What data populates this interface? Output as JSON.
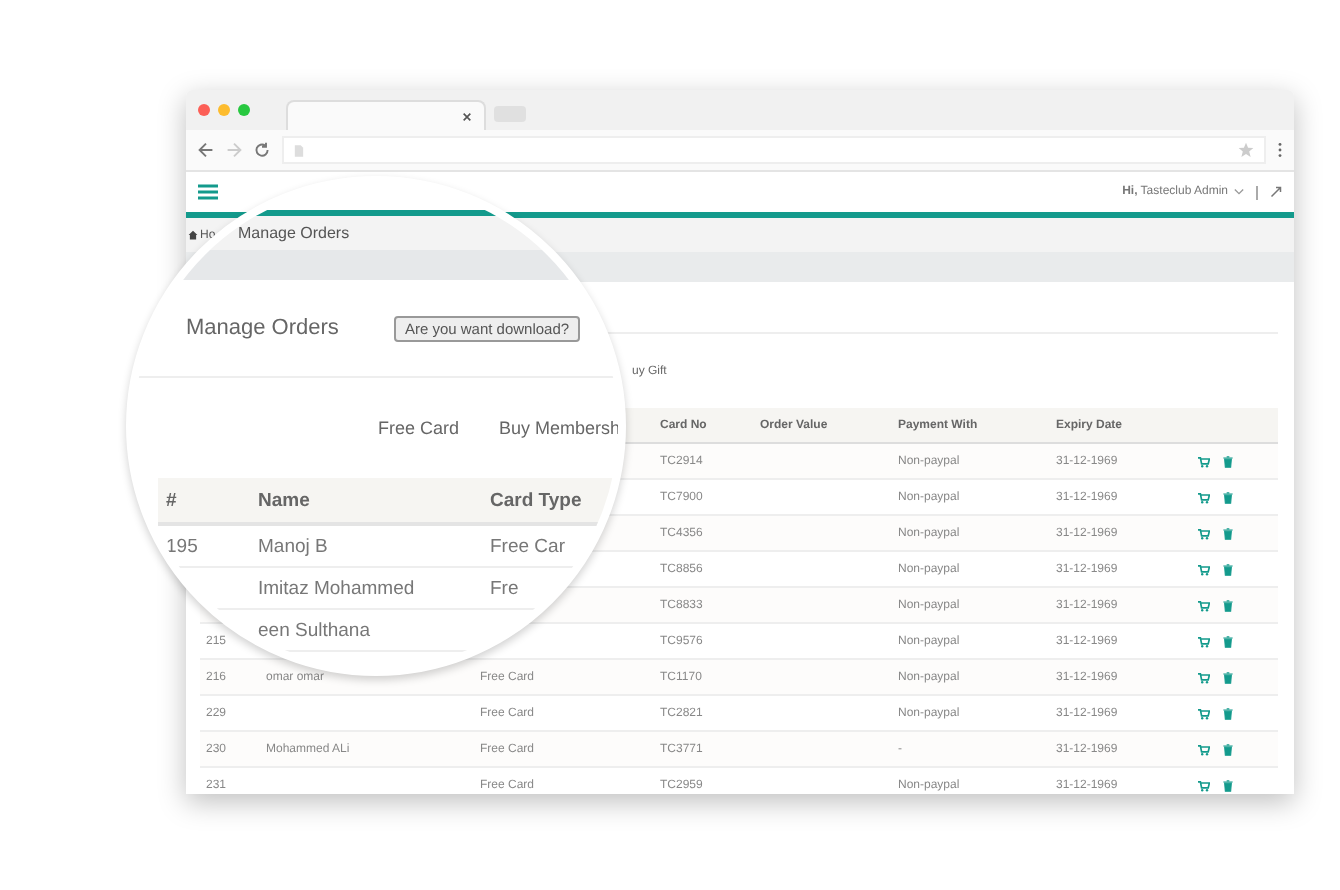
{
  "app_header": {
    "greeting": "Hi,",
    "user": "Tasteclub Admin"
  },
  "breadcrumb": {
    "home": "Ho"
  },
  "tabs": [
    {
      "label": "uy Gift",
      "selected": false
    }
  ],
  "table": {
    "columns": [
      "",
      "",
      "",
      "Card No",
      "Order Value",
      "Payment With",
      "Expiry Date"
    ],
    "rows": [
      {
        "id": "",
        "name": "",
        "card_type": "",
        "card_no": "TC2914",
        "order_value": "",
        "payment": "Non-paypal",
        "expiry": "31-12-1969"
      },
      {
        "id": "",
        "name": "",
        "card_type": "",
        "card_no": "TC7900",
        "order_value": "",
        "payment": "Non-paypal",
        "expiry": "31-12-1969"
      },
      {
        "id": "",
        "name": "",
        "card_type": "",
        "card_no": "TC4356",
        "order_value": "",
        "payment": "Non-paypal",
        "expiry": "31-12-1969"
      },
      {
        "id": "",
        "name": "",
        "card_type": "",
        "card_no": "TC8856",
        "order_value": "",
        "payment": "Non-paypal",
        "expiry": "31-12-1969"
      },
      {
        "id": "",
        "name": "",
        "card_type": "",
        "card_no": "TC8833",
        "order_value": "",
        "payment": "Non-paypal",
        "expiry": "31-12-1969"
      },
      {
        "id": "215",
        "name": "",
        "card_type": "",
        "card_no": "TC9576",
        "order_value": "",
        "payment": "Non-paypal",
        "expiry": "31-12-1969"
      },
      {
        "id": "216",
        "name": "omar omar",
        "card_type": "Free Card",
        "card_no": "TC1170",
        "order_value": "",
        "payment": "Non-paypal",
        "expiry": "31-12-1969"
      },
      {
        "id": "229",
        "name": "",
        "card_type": "Free Card",
        "card_no": "TC2821",
        "order_value": "",
        "payment": "Non-paypal",
        "expiry": "31-12-1969"
      },
      {
        "id": "230",
        "name": "Mohammed ALi",
        "card_type": "Free Card",
        "card_no": "TC3771",
        "order_value": "",
        "payment": "-",
        "expiry": "31-12-1969"
      },
      {
        "id": "231",
        "name": "",
        "card_type": "Free Card",
        "card_no": "TC2959",
        "order_value": "",
        "payment": "Non-paypal",
        "expiry": "31-12-1969"
      }
    ]
  },
  "magnifier": {
    "breadcrumb": "Manage Orders",
    "title": "Manage Orders",
    "download_button": "Are you want download?",
    "tabs": [
      {
        "label": "Free Card",
        "selected": false
      },
      {
        "label": "Buy Membersh",
        "selected": false
      }
    ],
    "columns": [
      "#",
      "Name",
      "Card Type"
    ],
    "rows": [
      {
        "id": "195",
        "name": "Manoj B",
        "card_type": "Free Car"
      },
      {
        "id": "",
        "name": "Imitaz Mohammed",
        "card_type": "Fre"
      },
      {
        "id": "",
        "name": "een Sulthana",
        "card_type": ""
      }
    ]
  }
}
